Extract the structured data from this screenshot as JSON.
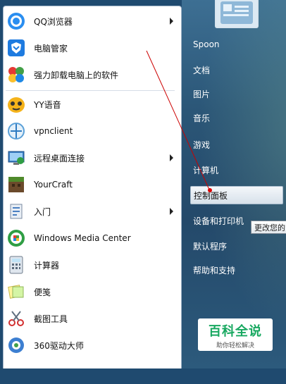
{
  "programs": [
    {
      "label": "QQ浏览器",
      "icon": "qq-browser-icon",
      "has_arrow": true
    },
    {
      "label": "电脑管家",
      "icon": "pc-manager-shield-icon",
      "has_arrow": false
    },
    {
      "label": "强力卸载电脑上的软件",
      "icon": "uninstaller-icon",
      "has_arrow": false
    },
    {
      "label": "YY语音",
      "icon": "yy-voice-icon",
      "has_arrow": false
    },
    {
      "label": "vpnclient",
      "icon": "vpn-client-icon",
      "has_arrow": false
    },
    {
      "label": "远程桌面连接",
      "icon": "remote-desktop-icon",
      "has_arrow": true
    },
    {
      "label": "YourCraft",
      "icon": "yourcraft-icon",
      "has_arrow": false
    },
    {
      "label": "入门",
      "icon": "getting-started-icon",
      "has_arrow": true
    },
    {
      "label": "Windows Media Center",
      "icon": "windows-media-center-icon",
      "has_arrow": false
    },
    {
      "label": "计算器",
      "icon": "calculator-icon",
      "has_arrow": false
    },
    {
      "label": "便笺",
      "icon": "sticky-notes-icon",
      "has_arrow": false
    },
    {
      "label": "截图工具",
      "icon": "snipping-tool-icon",
      "has_arrow": false
    },
    {
      "label": "360驱动大师",
      "icon": "driver-master-360-icon",
      "has_arrow": false
    }
  ],
  "right_items": [
    {
      "label": "Spoon"
    },
    {
      "label": "文档"
    },
    {
      "label": "图片"
    },
    {
      "label": "音乐"
    },
    {
      "label": "游戏"
    },
    {
      "label": "计算机"
    },
    {
      "label": "控制面板",
      "highlighted": true
    },
    {
      "label": "设备和打印机"
    },
    {
      "label": "默认程序"
    },
    {
      "label": "帮助和支持"
    }
  ],
  "tooltip": {
    "text": "更改您的"
  },
  "watermark": {
    "title": "百科全说",
    "subtitle": "助你轻松解决"
  },
  "colors": {
    "accent": "#18a860",
    "annotation": "#cc0000"
  }
}
